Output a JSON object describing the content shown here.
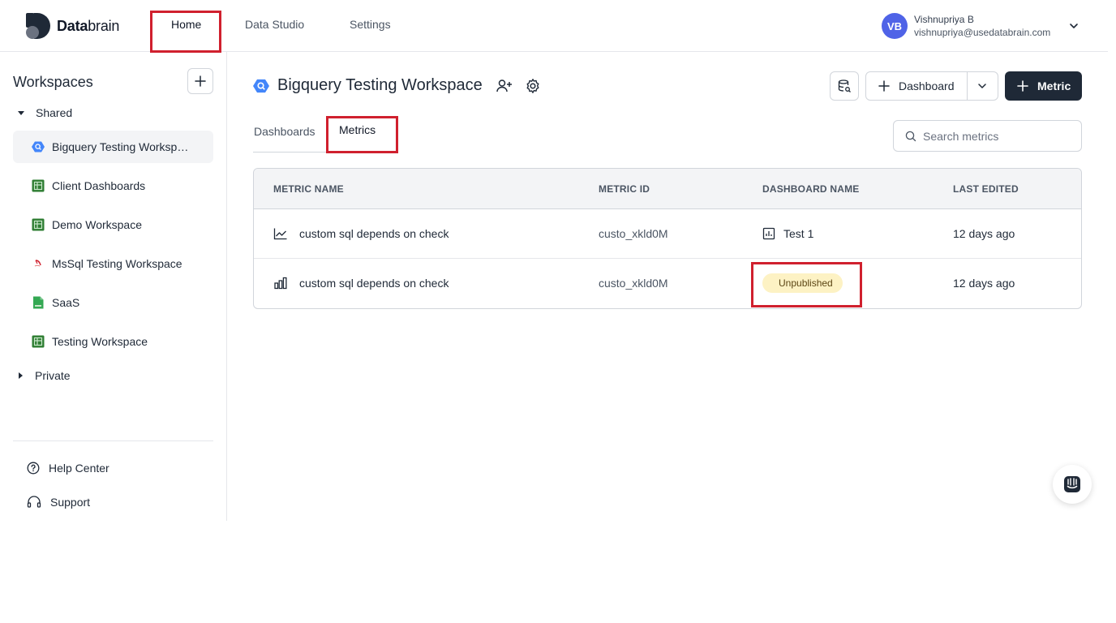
{
  "brand": {
    "bold": "Data",
    "light": "brain"
  },
  "nav": {
    "home": "Home",
    "data_studio": "Data Studio",
    "settings": "Settings"
  },
  "user": {
    "initials": "VB",
    "name": "Vishnupriya B",
    "email": "vishnupriya@usedatabrain.com"
  },
  "sidebar": {
    "title": "Workspaces",
    "shared_label": "Shared",
    "private_label": "Private",
    "items": [
      {
        "label": "Bigquery Testing Workspace",
        "icon": "bigquery-icon"
      },
      {
        "label": "Client Dashboards",
        "icon": "sheets-icon"
      },
      {
        "label": "Demo Workspace",
        "icon": "sheets-icon"
      },
      {
        "label": "MsSql Testing Workspace",
        "icon": "mssql-icon"
      },
      {
        "label": "SaaS",
        "icon": "csv-icon"
      },
      {
        "label": "Testing Workspace",
        "icon": "sheets-icon"
      }
    ],
    "help_center": "Help Center",
    "support": "Support"
  },
  "workspace": {
    "name": "Bigquery Testing Workspace"
  },
  "toolbar": {
    "dashboard_label": "Dashboard",
    "metric_label": "Metric"
  },
  "tabs": {
    "dashboards": "Dashboards",
    "metrics": "Metrics"
  },
  "search": {
    "placeholder": "Search metrics"
  },
  "table": {
    "headers": {
      "metric_name": "METRIC NAME",
      "metric_id": "METRIC ID",
      "dashboard_name": "DASHBOARD NAME",
      "last_edited": "LAST EDITED"
    },
    "rows": [
      {
        "metric_name": "custom sql depends on check",
        "metric_id": "custo_xkld0M",
        "dashboard_name": "Test 1",
        "last_edited": "12 days ago",
        "chart_icon": "line-chart-icon"
      },
      {
        "metric_name": "custom sql depends on check",
        "metric_id": "custo_xkld0M",
        "status": "Unpublished",
        "last_edited": "12 days ago",
        "chart_icon": "bar-chart-icon"
      }
    ]
  },
  "colors": {
    "accent_dark": "#1f2937",
    "avatar": "#4f63e7",
    "highlight": "#d0202e",
    "badge_bg": "#fdf2c4"
  }
}
